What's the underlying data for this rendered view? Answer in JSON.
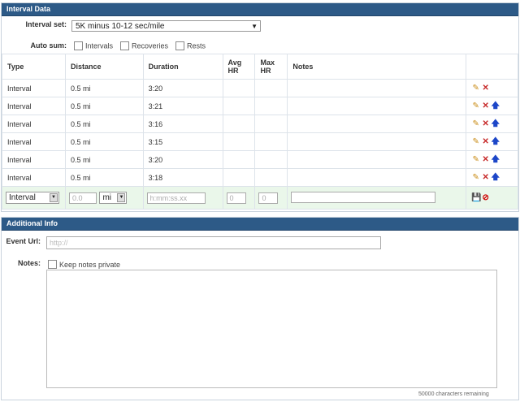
{
  "interval_panel": {
    "title": "Interval Data",
    "interval_set_label": "Interval set:",
    "interval_set_value": "5K minus 10-12 sec/mile",
    "auto_sum_label": "Auto sum:",
    "auto_sum_options": [
      "Intervals",
      "Recoveries",
      "Rests"
    ],
    "columns": [
      "Type",
      "Distance",
      "Duration",
      "Avg HR",
      "Max HR",
      "Notes",
      ""
    ],
    "rows": [
      {
        "type": "Interval",
        "distance": "0.5 mi",
        "duration": "3:20",
        "avg_hr": "",
        "max_hr": "",
        "notes": ""
      },
      {
        "type": "Interval",
        "distance": "0.5 mi",
        "duration": "3:21",
        "avg_hr": "",
        "max_hr": "",
        "notes": ""
      },
      {
        "type": "Interval",
        "distance": "0.5 mi",
        "duration": "3:16",
        "avg_hr": "",
        "max_hr": "",
        "notes": ""
      },
      {
        "type": "Interval",
        "distance": "0.5 mi",
        "duration": "3:15",
        "avg_hr": "",
        "max_hr": "",
        "notes": ""
      },
      {
        "type": "Interval",
        "distance": "0.5 mi",
        "duration": "3:20",
        "avg_hr": "",
        "max_hr": "",
        "notes": ""
      },
      {
        "type": "Interval",
        "distance": "0.5 mi",
        "duration": "3:18",
        "avg_hr": "",
        "max_hr": "",
        "notes": ""
      }
    ],
    "new_row": {
      "type_value": "Interval",
      "distance_placeholder": "0.0",
      "unit_value": "mi",
      "duration_placeholder": "h:mm:ss.xx",
      "avg_hr_placeholder": "0",
      "max_hr_placeholder": "0"
    }
  },
  "info_panel": {
    "title": "Additional Info",
    "event_url_label": "Event Url:",
    "event_url_placeholder": "http://",
    "notes_label": "Notes:",
    "keep_private_label": "Keep notes private",
    "remaining_text": "50000 characters remaining"
  },
  "icons": {
    "edit": "pencil-icon",
    "delete": "delete-x-icon",
    "move_up": "arrow-up-icon",
    "save": "floppy-save-icon",
    "cancel": "cancel-circle-icon"
  },
  "colors": {
    "header_bg": "#2d5a87",
    "new_row_bg": "#eaf7ea",
    "delete": "#c72a2a",
    "move_up": "#1c46c8",
    "edit": "#c98a12"
  }
}
